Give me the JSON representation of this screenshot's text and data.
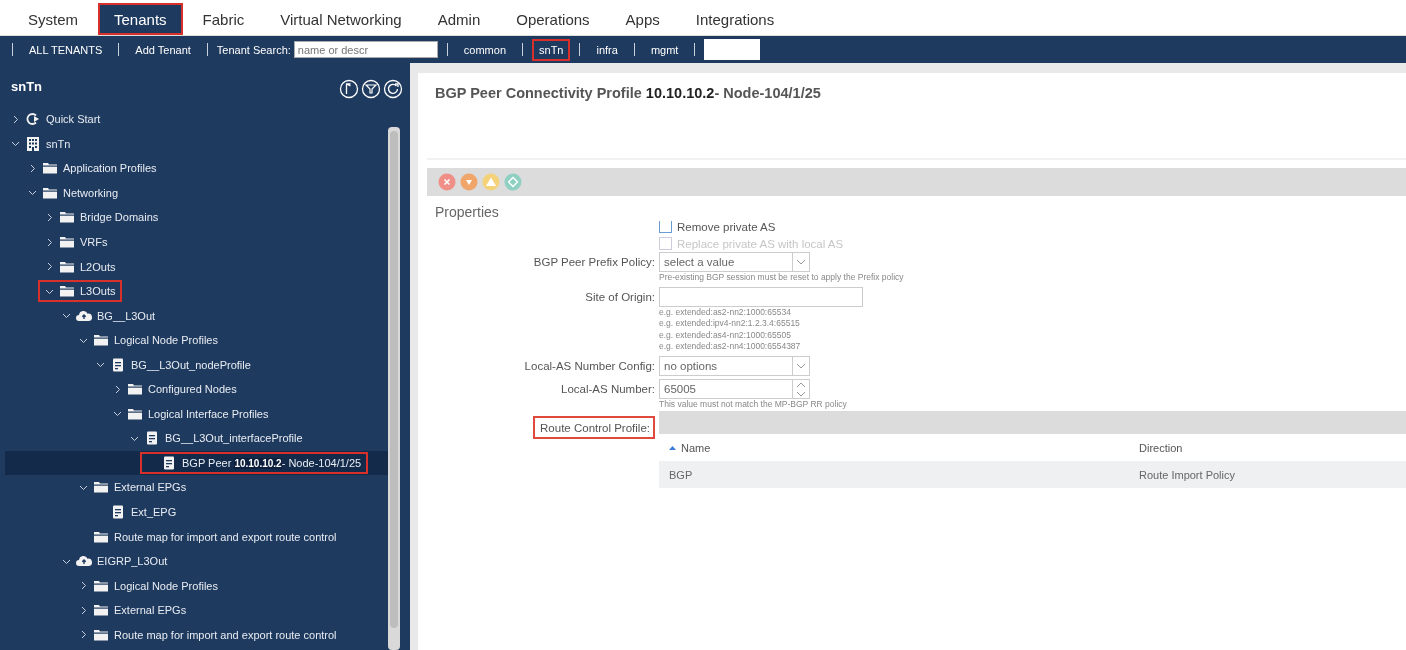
{
  "top_nav": [
    {
      "label": "System",
      "selected": false,
      "highlighted": false
    },
    {
      "label": "Tenants",
      "selected": true,
      "highlighted": true
    },
    {
      "label": "Fabric",
      "selected": false,
      "highlighted": false
    },
    {
      "label": "Virtual Networking",
      "selected": false,
      "highlighted": false
    },
    {
      "label": "Admin",
      "selected": false,
      "highlighted": false
    },
    {
      "label": "Operations",
      "selected": false,
      "highlighted": false
    },
    {
      "label": "Apps",
      "selected": false,
      "highlighted": false
    },
    {
      "label": "Integrations",
      "selected": false,
      "highlighted": false
    }
  ],
  "tenant_bar": {
    "items": [
      {
        "kind": "link",
        "label": "ALL TENANTS"
      },
      {
        "kind": "link",
        "label": "Add Tenant"
      },
      {
        "kind": "search",
        "label": "Tenant Search:",
        "placeholder": "name or descr"
      },
      {
        "kind": "tenant",
        "label": "common",
        "highlighted": false
      },
      {
        "kind": "tenant",
        "label": "snTn",
        "highlighted": true
      },
      {
        "kind": "tenant",
        "label": "infra",
        "highlighted": false
      },
      {
        "kind": "tenant",
        "label": "mgmt",
        "highlighted": false
      },
      {
        "kind": "blank"
      }
    ]
  },
  "sidebar": {
    "title": "snTn",
    "tree": [
      {
        "label": "Quick Start",
        "kind": "quickstart",
        "expanded": false,
        "selected": false,
        "highlighted": false
      },
      {
        "label": "snTn",
        "kind": "building",
        "expanded": true,
        "selected": false,
        "highlighted": false,
        "children": [
          {
            "label": "Application Profiles",
            "kind": "folder",
            "expanded": false,
            "selected": false,
            "highlighted": false
          },
          {
            "label": "Networking",
            "kind": "folder",
            "expanded": true,
            "selected": false,
            "highlighted": false,
            "children": [
              {
                "label": "Bridge Domains",
                "kind": "folder",
                "expanded": false,
                "selected": false,
                "highlighted": false
              },
              {
                "label": "VRFs",
                "kind": "folder",
                "expanded": false,
                "selected": false,
                "highlighted": false
              },
              {
                "label": "L2Outs",
                "kind": "folder",
                "expanded": false,
                "selected": false,
                "highlighted": false
              },
              {
                "label": "L3Outs",
                "kind": "folder",
                "expanded": true,
                "selected": false,
                "highlighted": true,
                "children": [
                  {
                    "label": "BG__L3Out",
                    "kind": "cloud",
                    "expanded": true,
                    "selected": false,
                    "highlighted": false,
                    "children": [
                      {
                        "label": "Logical Node Profiles",
                        "kind": "folder",
                        "expanded": true,
                        "selected": false,
                        "highlighted": false,
                        "children": [
                          {
                            "label": "BG__L3Out_nodeProfile",
                            "kind": "doc",
                            "expanded": true,
                            "selected": false,
                            "highlighted": false,
                            "children": [
                              {
                                "label": "Configured Nodes",
                                "kind": "folder",
                                "expanded": false,
                                "selected": false,
                                "highlighted": false
                              },
                              {
                                "label": "Logical Interface Profiles",
                                "kind": "folder",
                                "expanded": true,
                                "selected": false,
                                "highlighted": false,
                                "children": [
                                  {
                                    "label": "BG__L3Out_interfaceProfile",
                                    "kind": "doc",
                                    "expanded": true,
                                    "selected": false,
                                    "highlighted": false,
                                    "children": [
                                      {
                                        "label": "BGP Peer **10.10.10.2**- Node-104/1/25",
                                        "kind": "doc",
                                        "selected": true,
                                        "highlighted": true
                                      }
                                    ]
                                  }
                                ]
                              }
                            ]
                          }
                        ]
                      },
                      {
                        "label": "External EPGs",
                        "kind": "folder",
                        "expanded": true,
                        "selected": false,
                        "highlighted": false,
                        "children": [
                          {
                            "label": "Ext_EPG",
                            "kind": "doc",
                            "selected": false,
                            "highlighted": false
                          }
                        ]
                      },
                      {
                        "label": "Route map for import and export route control",
                        "kind": "folder",
                        "selected": false,
                        "highlighted": false
                      }
                    ]
                  },
                  {
                    "label": "EIGRP_L3Out",
                    "kind": "cloud",
                    "expanded": true,
                    "selected": false,
                    "highlighted": false,
                    "children": [
                      {
                        "label": "Logical Node Profiles",
                        "kind": "folder",
                        "expanded": false,
                        "selected": false,
                        "highlighted": false
                      },
                      {
                        "label": "External EPGs",
                        "kind": "folder",
                        "expanded": false,
                        "selected": false,
                        "highlighted": false
                      },
                      {
                        "label": "Route map for import and export route control",
                        "kind": "folder",
                        "expanded": false,
                        "selected": false,
                        "highlighted": false
                      }
                    ]
                  }
                ]
              }
            ]
          }
        ]
      }
    ]
  },
  "detail": {
    "title": "BGP Peer Connectivity Profile",
    "name": "**10.10.10.2**- Node-104/1/25",
    "section": "Properties",
    "fields": [
      {
        "kind": "checkbox",
        "label": "Remove private AS",
        "checked": false,
        "disabled": false
      },
      {
        "kind": "checkbox",
        "label": "Replace private AS with local AS",
        "checked": false,
        "disabled": true
      },
      {
        "kind": "select",
        "label": "BGP Peer Prefix Policy:",
        "value": "select a value",
        "hints": [
          "Pre-existing BGP session must be reset to apply the Prefix policy"
        ]
      },
      {
        "kind": "text",
        "label": "Site of Origin:",
        "hints": [
          "e.g. extended:as2-nn2:1000:65534",
          "e.g. extended:ipv4-nn2:1.2.3.4:65515",
          "e.g. extended:as4-nn2:1000:65505",
          "e.g. extended:as2-nn4:1000:6554387"
        ]
      },
      {
        "kind": "select",
        "label": "Local-AS Number Config:",
        "value": "no options"
      },
      {
        "kind": "number",
        "label": "Local-AS Number:",
        "value": "65005",
        "hints": [
          "This value must not match the MP-BGP RR policy"
        ]
      },
      {
        "kind": "table",
        "label": "Route Control Profile:",
        "highlighted": true,
        "columns": [
          {
            "label": "Name",
            "sorted": true
          },
          {
            "label": "Direction",
            "sorted": false
          }
        ],
        "rows": [
          [
            "BGP",
            "Route Import Policy"
          ]
        ]
      }
    ]
  }
}
